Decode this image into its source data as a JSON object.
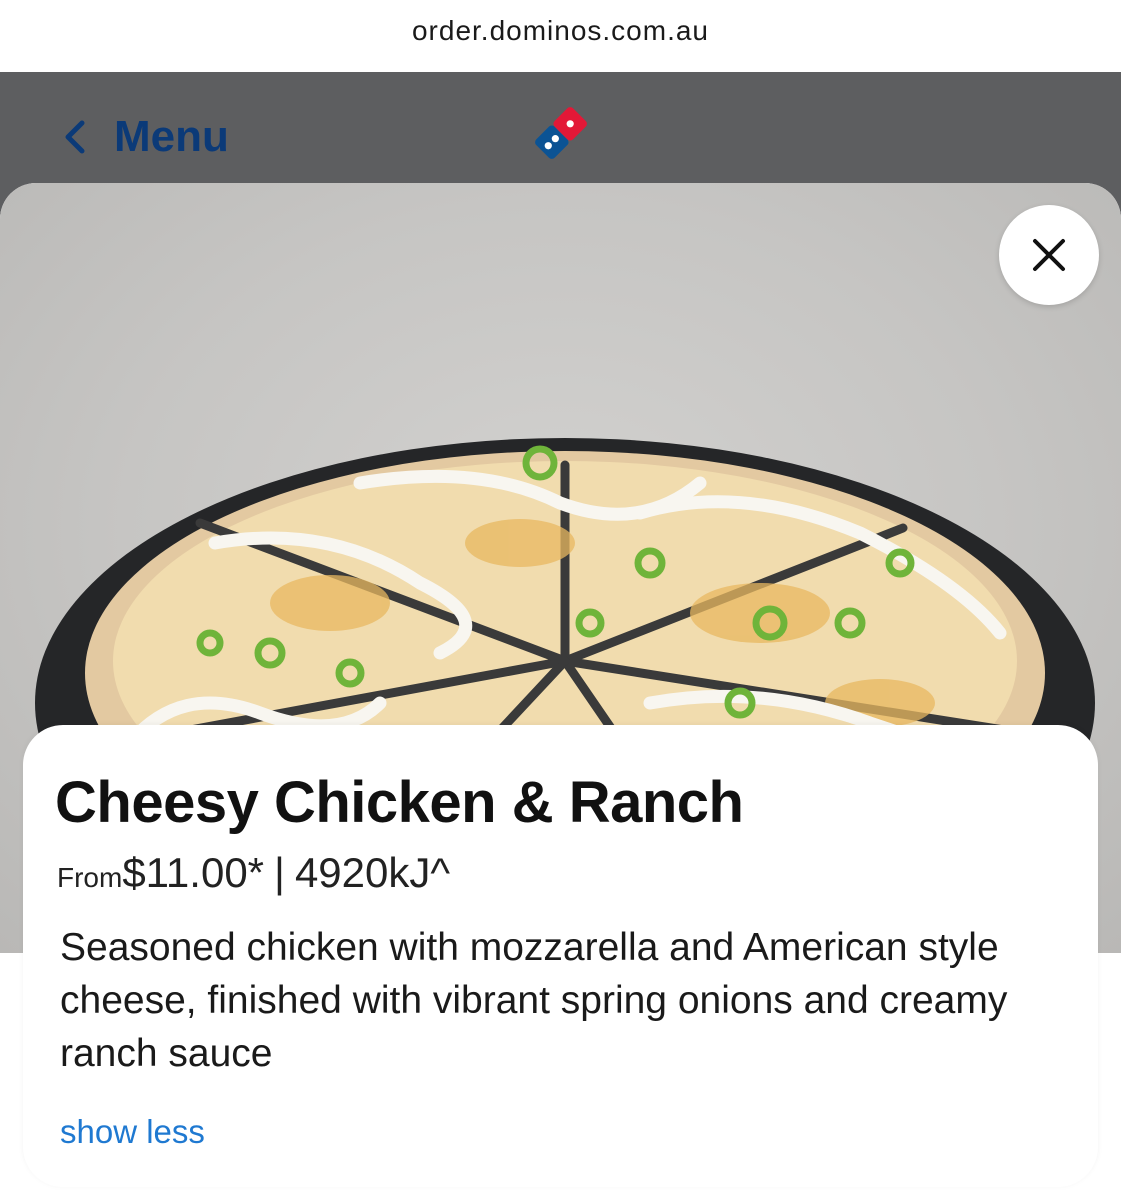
{
  "browser": {
    "url": "order.dominos.com.au"
  },
  "header": {
    "back_label": "Menu",
    "logo_icon": "dominos-logo-icon"
  },
  "colors": {
    "header_bg": "#5d5e60",
    "back_link": "#0b3a78",
    "link_blue": "#1f79d1",
    "logo_blue": "#0b5394",
    "logo_red": "#e31837"
  },
  "product": {
    "name": "Cheesy Chicken & Ranch",
    "price_prefix": "From",
    "price": "$11.00*",
    "separator": "|",
    "energy": "4920kJ^",
    "description": "Seasoned chicken with mozzarella and American style cheese, finished with vibrant spring onions and creamy ranch sauce",
    "toggle_label": "show less"
  },
  "modal": {
    "close_icon": "close-icon"
  }
}
